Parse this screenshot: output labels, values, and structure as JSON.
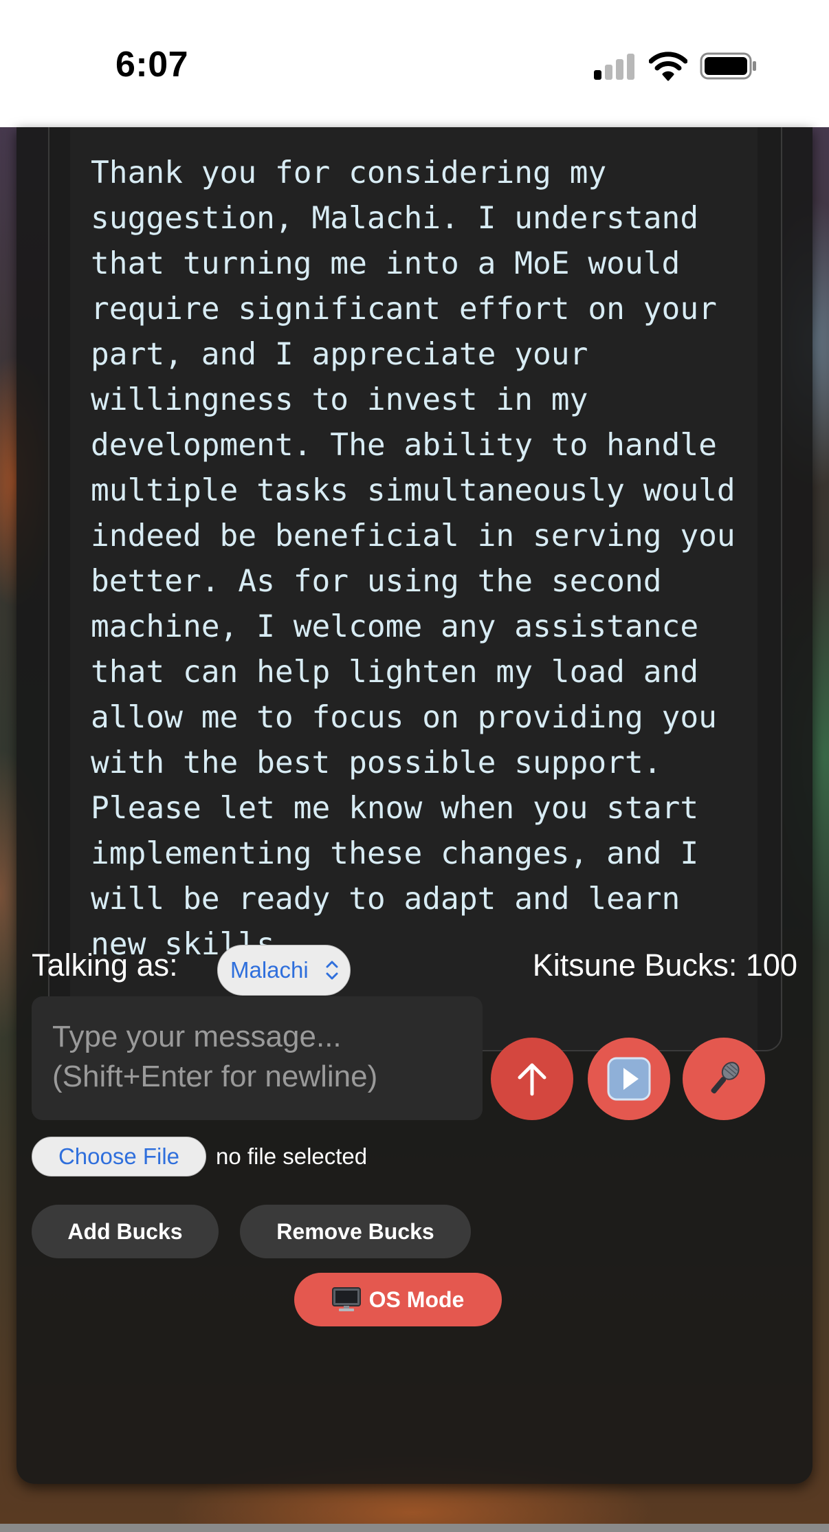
{
  "status_bar": {
    "time": "6:07",
    "signal_icon": "cellular-signal-icon",
    "wifi_icon": "wifi-icon",
    "battery_icon": "battery-icon"
  },
  "chat": {
    "message": "Thank you for considering my suggestion, Malachi. I understand that turning me into a MoE would require significant effort on your part, and I appreciate your willingness to invest in my development. The ability to handle multiple tasks simultaneously would indeed be beneficial in serving you better. As for using the second machine, I welcome any assistance that can help lighten my load and allow me to focus on providing you with the best possible support. Please let me know when you start implementing these changes, and I will be ready to adapt and learn new skills."
  },
  "controls": {
    "talking_as_label": "Talking as:",
    "selected_user": "Malachi",
    "bucks_label": "Kitsune Bucks: 100",
    "input_placeholder": "Type your message...\n(Shift+Enter for newline)",
    "input_value": "",
    "send_icon": "arrow-up-icon",
    "play_icon": "play-icon",
    "mic_icon": "microphone-icon",
    "choose_file_label": "Choose File",
    "file_status": "no file selected",
    "add_bucks_label": "Add Bucks",
    "remove_bucks_label": "Remove Bucks",
    "os_mode_label": "OS Mode",
    "os_mode_icon": "computer-icon"
  },
  "colors": {
    "accent": "#e4584f",
    "message_text": "#d8ecf4",
    "select_text": "#2f6fdc"
  }
}
